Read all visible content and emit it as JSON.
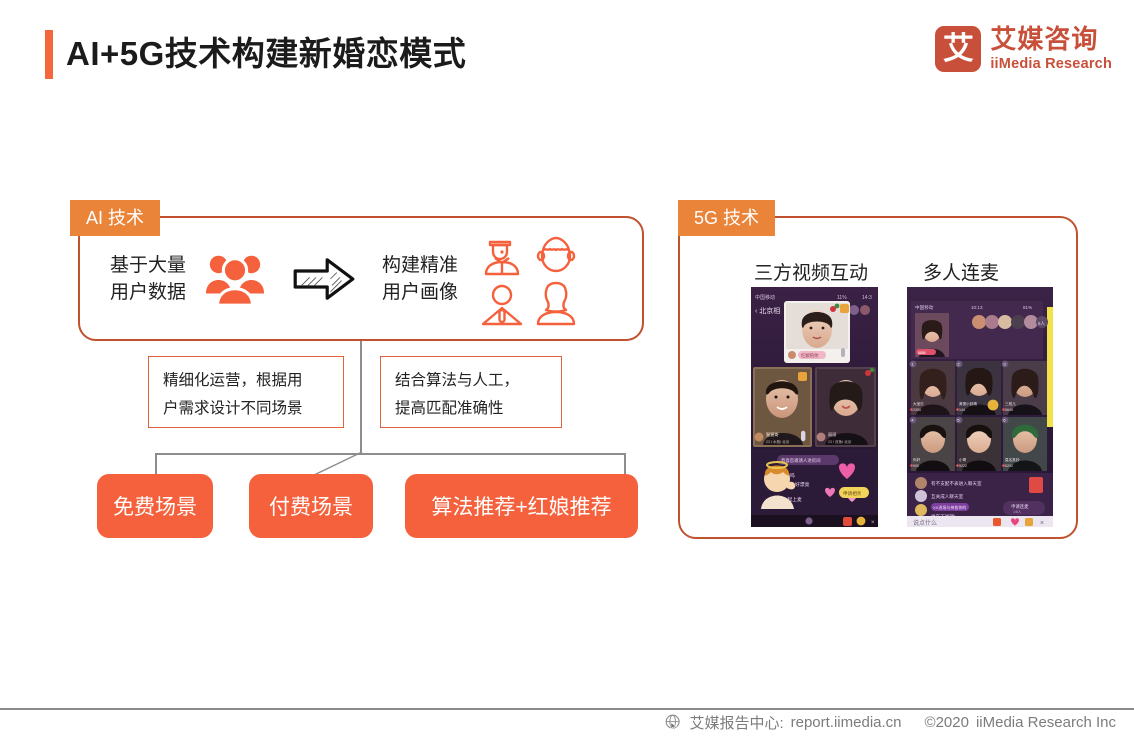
{
  "header": {
    "title": "AI+5G技术构建新婚恋模式",
    "accent_color": "#F4673D",
    "logo": {
      "mark_char": "艾",
      "name_cn": "艾媒咨询",
      "name_en": "iiMedia Research",
      "color": "#C8503A"
    }
  },
  "ai_section": {
    "tab_label": "AI 技术",
    "left_text_line1": "基于大量",
    "left_text_line2": "用户数据",
    "people_icon": "group-people-icon",
    "arrow_icon": "sketch-right-arrow-icon",
    "right_text_line1": "构建精准",
    "right_text_line2": "用户画像",
    "avatar_icons": [
      "avatar-man-suit-icon",
      "avatar-boy-icon",
      "avatar-person-tie-icon",
      "avatar-woman-icon"
    ],
    "notes": [
      {
        "line1": "精细化运营，根据用",
        "line2": "户需求设计不同场景"
      },
      {
        "line1": "结合算法与人工，",
        "line2": "提高匹配准确性"
      }
    ],
    "scenarios": [
      {
        "label": "免费场景"
      },
      {
        "label": "付费场景"
      },
      {
        "label": "算法推荐+红娘推荐"
      }
    ]
  },
  "g5_section": {
    "tab_label": "5G 技术",
    "columns": [
      {
        "label": "三方视频互动",
        "screenshot_name": "three-way-video-chat-screenshot"
      },
      {
        "label": "多人连麦",
        "screenshot_name": "multi-person-live-mic-screenshot"
      }
    ]
  },
  "footer": {
    "globe_icon": "globe-cursor-icon",
    "report_center": "艾媒报告中心:",
    "url": "report.iimedia.cn",
    "copyright": "©2020",
    "company": "iiMedia Research  Inc"
  },
  "colors": {
    "orange_fill": "#F4613C",
    "orange_tab": "#EA8439",
    "panel_border": "#C0522F",
    "note_border": "#E2643C",
    "connector": "#8d8d8d"
  }
}
